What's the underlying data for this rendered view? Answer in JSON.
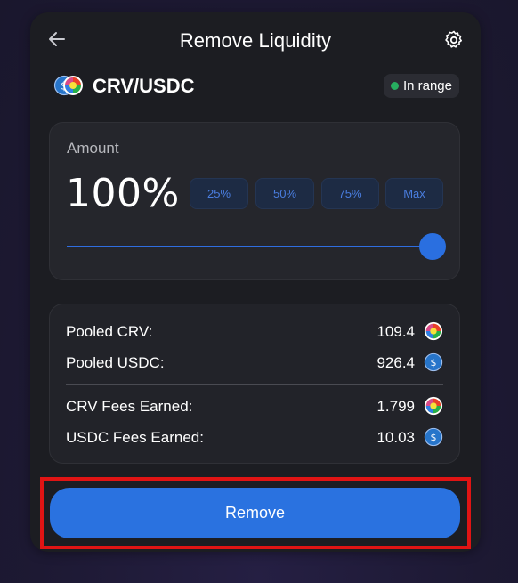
{
  "header": {
    "title": "Remove Liquidity",
    "back_icon": "arrow-left-icon",
    "settings_icon": "gear-icon"
  },
  "pair": {
    "name": "CRV/USDC",
    "status": "In range",
    "status_color": "#27ae60"
  },
  "amount": {
    "label": "Amount",
    "value": "100%",
    "slider_fraction": 1.0,
    "presets": [
      "25%",
      "50%",
      "75%",
      "Max"
    ]
  },
  "pooled": [
    {
      "label": "Pooled CRV:",
      "value": "109.4",
      "token_icon": "crv-token-icon"
    },
    {
      "label": "Pooled USDC:",
      "value": "926.4",
      "token_icon": "usdc-token-icon"
    }
  ],
  "fees": [
    {
      "label": "CRV Fees Earned:",
      "value": "1.799",
      "token_icon": "crv-token-icon"
    },
    {
      "label": "USDC Fees Earned:",
      "value": "10.03",
      "token_icon": "usdc-token-icon"
    }
  ],
  "action": {
    "remove_label": "Remove",
    "accent": "#2a72e0",
    "highlight": "#e01414"
  }
}
